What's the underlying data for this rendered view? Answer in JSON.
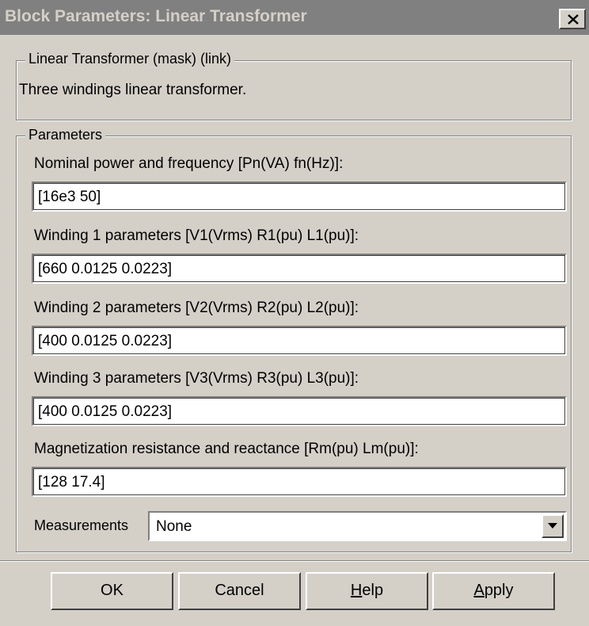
{
  "window": {
    "title": "Block Parameters: Linear Transformer",
    "close_glyph": "close-icon"
  },
  "description_group": {
    "legend": "Linear Transformer (mask) (link)",
    "text": "Three windings linear transformer."
  },
  "parameters_group": {
    "legend": "Parameters",
    "fields": [
      {
        "label": "Nominal power and frequency [Pn(VA) fn(Hz)]:",
        "value": "[16e3 50]"
      },
      {
        "label": "Winding 1 parameters [V1(Vrms) R1(pu) L1(pu)]:",
        "value": "[660 0.0125 0.0223]"
      },
      {
        "label": "Winding 2 parameters [V2(Vrms) R2(pu) L2(pu)]:",
        "value": "[400 0.0125 0.0223]"
      },
      {
        "label": "Winding 3 parameters [V3(Vrms) R3(pu) L3(pu)]:",
        "value": "[400 0.0125 0.0223]"
      },
      {
        "label": "Magnetization resistance and reactance [Rm(pu) Lm(pu)]:",
        "value": "[128 17.4]"
      }
    ],
    "measurements": {
      "label": "Measurements",
      "selected": "None",
      "arrow_icon": "chevron-down-icon"
    }
  },
  "buttons": {
    "ok": "OK",
    "cancel": "Cancel",
    "help_mnemonic": "H",
    "help_rest": "elp",
    "apply_mnemonic": "A",
    "apply_rest": "pply"
  },
  "colors": {
    "face": "#d4d0c8",
    "titlebar_inactive": "#808080",
    "titlebar_text": "#d4d0c8"
  }
}
